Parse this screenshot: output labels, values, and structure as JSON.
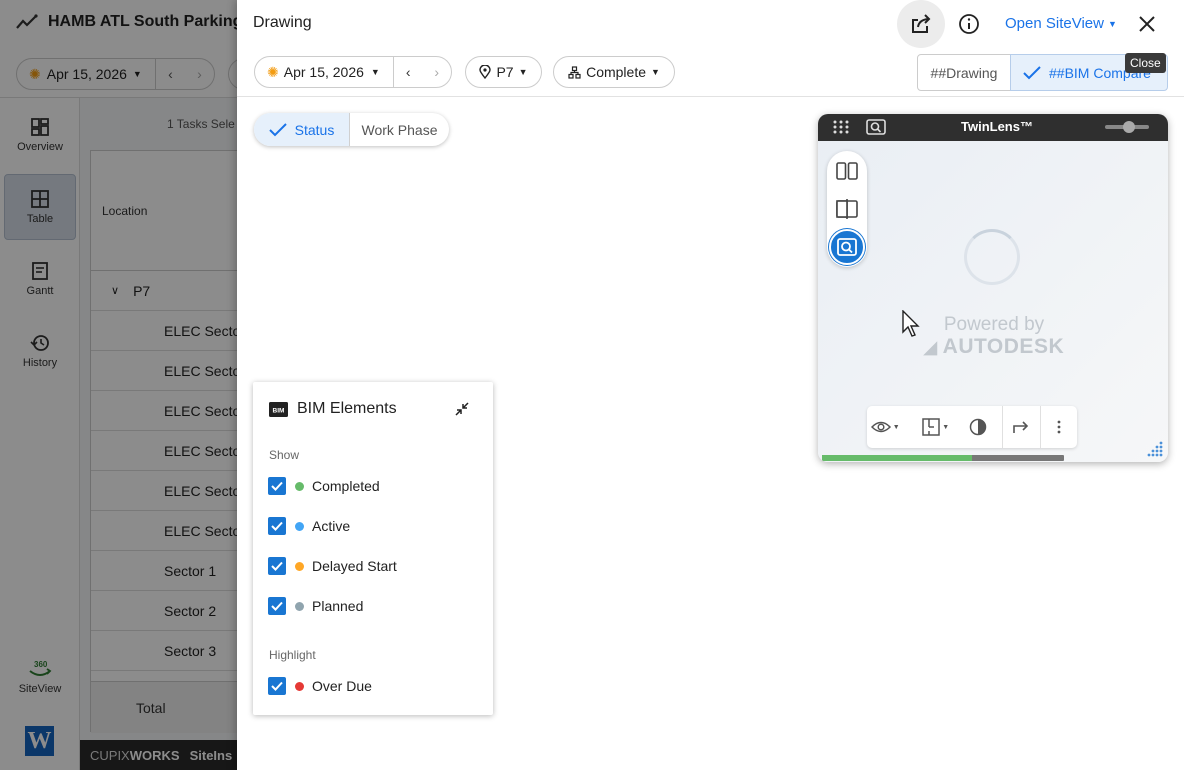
{
  "app": {
    "title": "HAMB ATL South Parking",
    "date": "Apr 15, 2026",
    "tasks_selected": "1 Tasks Sele",
    "sidebar": [
      {
        "label": "Overview",
        "icon": "dashboard-icon"
      },
      {
        "label": "Table",
        "icon": "table-icon"
      },
      {
        "label": "Gantt",
        "icon": "gantt-icon"
      },
      {
        "label": "History",
        "icon": "history-icon"
      },
      {
        "label": "SiteView",
        "icon": "siteview-360-icon"
      }
    ],
    "table": {
      "header": "Location",
      "group": "P7",
      "rows": [
        "ELEC Sector",
        "ELEC Sector",
        "ELEC Sector",
        "ELEC Sector",
        "ELEC Sector",
        "ELEC Sector",
        "Sector 1",
        "Sector 2",
        "Sector 3"
      ],
      "total": "Total"
    },
    "footer": {
      "brand_a": "CUPIX",
      "brand_b": "WORKS",
      "text": "SiteIns"
    }
  },
  "drawer": {
    "title": "Drawing",
    "open_siteview": "Open SiteView",
    "close_tooltip": "Close",
    "date": "Apr 15, 2026",
    "location": "P7",
    "status_filter": "Complete",
    "toggle": {
      "drawing": "##Drawing",
      "bim": "##BIM Compare"
    },
    "segment": {
      "status": "Status",
      "work_phase": "Work Phase"
    }
  },
  "bim_panel": {
    "title": "BIM Elements",
    "show_label": "Show",
    "show_items": [
      {
        "label": "Completed",
        "color": "#66bb6a",
        "checked": true
      },
      {
        "label": "Active",
        "color": "#42a5f5",
        "checked": true
      },
      {
        "label": "Delayed Start",
        "color": "#ffa726",
        "checked": true
      },
      {
        "label": "Planned",
        "color": "#90a4ae",
        "checked": true
      }
    ],
    "highlight_label": "Highlight",
    "highlight_items": [
      {
        "label": "Over Due",
        "color": "#e53935",
        "checked": true
      }
    ]
  },
  "twinlens": {
    "title": "TwinLens™",
    "powered_by": "Powered by",
    "autodesk": "AUTODESK",
    "load_progress": 0.62
  },
  "colors": {
    "accent": "#1a73e8",
    "checkbox": "#1976d2"
  }
}
